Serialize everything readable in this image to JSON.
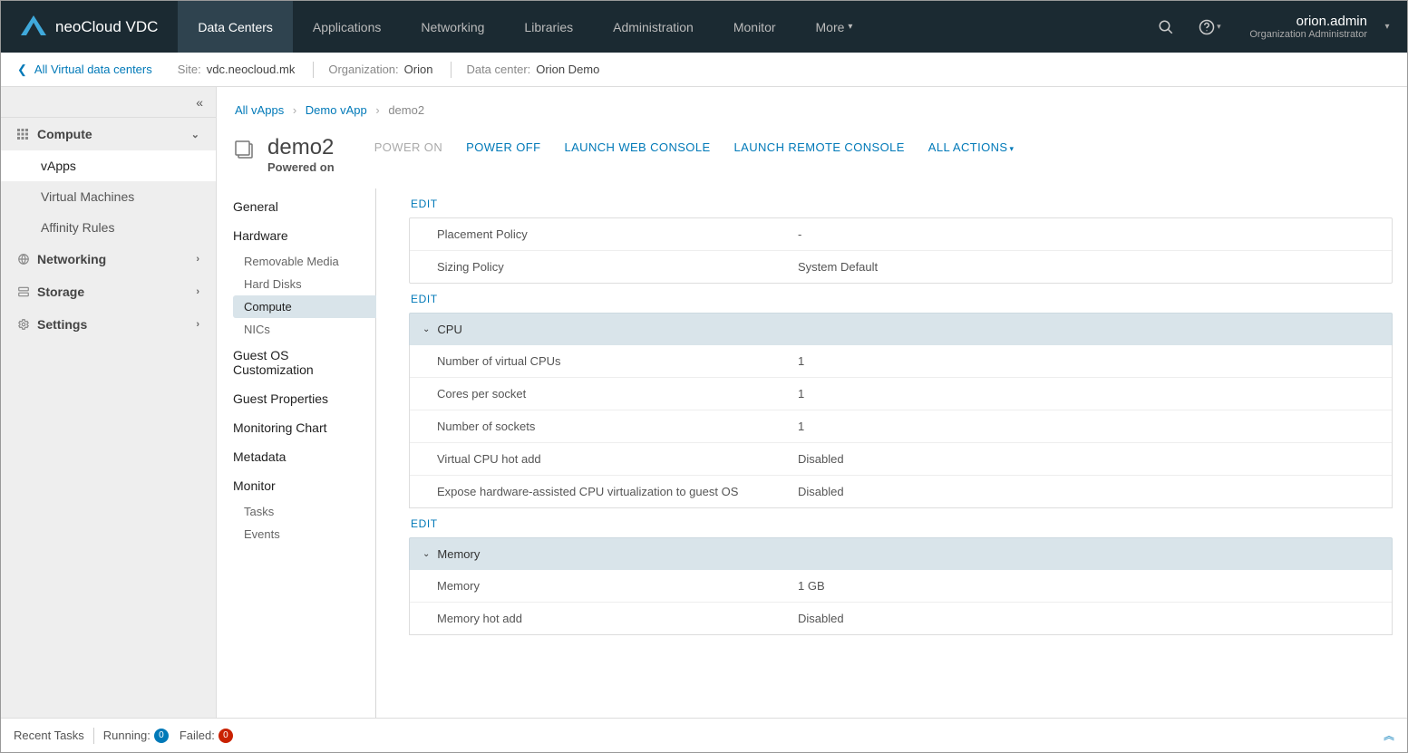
{
  "brand": "neoCloud VDC",
  "nav": {
    "tabs": [
      {
        "label": "Data Centers",
        "active": true
      },
      {
        "label": "Applications"
      },
      {
        "label": "Networking"
      },
      {
        "label": "Libraries"
      },
      {
        "label": "Administration"
      },
      {
        "label": "Monitor"
      },
      {
        "label": "More",
        "dropdown": true
      }
    ]
  },
  "user": {
    "name": "orion.admin",
    "role": "Organization Administrator"
  },
  "context": {
    "back": "All Virtual data centers",
    "site_lbl": "Site:",
    "site": "vdc.neocloud.mk",
    "org_lbl": "Organization:",
    "org": "Orion",
    "dc_lbl": "Data center:",
    "dc": "Orion Demo"
  },
  "sidebar1": {
    "groups": [
      {
        "label": "Compute",
        "icon": "grid",
        "open": true,
        "items": [
          {
            "label": "vApps",
            "active": true
          },
          {
            "label": "Virtual Machines"
          },
          {
            "label": "Affinity Rules"
          }
        ]
      },
      {
        "label": "Networking",
        "icon": "network",
        "open": false
      },
      {
        "label": "Storage",
        "icon": "storage",
        "open": false
      },
      {
        "label": "Settings",
        "icon": "gear",
        "open": false
      }
    ]
  },
  "crumbs": [
    {
      "label": "All vApps",
      "link": true
    },
    {
      "label": "Demo vApp",
      "link": true
    },
    {
      "label": "demo2",
      "link": false
    }
  ],
  "page": {
    "title": "demo2",
    "status": "Powered on",
    "actions": [
      {
        "label": "POWER ON",
        "disabled": true
      },
      {
        "label": "POWER OFF"
      },
      {
        "label": "LAUNCH WEB CONSOLE"
      },
      {
        "label": "LAUNCH REMOTE CONSOLE"
      },
      {
        "label": "ALL ACTIONS",
        "dropdown": true
      }
    ]
  },
  "sidebar2": [
    {
      "label": "General",
      "type": "head"
    },
    {
      "label": "Hardware",
      "type": "head"
    },
    {
      "label": "Removable Media",
      "type": "sub"
    },
    {
      "label": "Hard Disks",
      "type": "sub"
    },
    {
      "label": "Compute",
      "type": "sub",
      "active": true
    },
    {
      "label": "NICs",
      "type": "sub"
    },
    {
      "label": "Guest OS Customization",
      "type": "head"
    },
    {
      "label": "Guest Properties",
      "type": "head"
    },
    {
      "label": "Monitoring Chart",
      "type": "head"
    },
    {
      "label": "Metadata",
      "type": "head"
    },
    {
      "label": "Monitor",
      "type": "head"
    },
    {
      "label": "Tasks",
      "type": "sub"
    },
    {
      "label": "Events",
      "type": "sub"
    }
  ],
  "panel": {
    "edit_label": "EDIT",
    "policy_rows": [
      {
        "k": "Placement Policy",
        "v": "-"
      },
      {
        "k": "Sizing Policy",
        "v": "System Default"
      }
    ],
    "cpu_title": "CPU",
    "cpu_rows": [
      {
        "k": "Number of virtual CPUs",
        "v": "1"
      },
      {
        "k": "Cores per socket",
        "v": "1"
      },
      {
        "k": "Number of sockets",
        "v": "1"
      },
      {
        "k": "Virtual CPU hot add",
        "v": "Disabled"
      },
      {
        "k": "Expose hardware-assisted CPU virtualization to guest OS",
        "v": "Disabled"
      }
    ],
    "mem_title": "Memory",
    "mem_rows": [
      {
        "k": "Memory",
        "v": "1 GB"
      },
      {
        "k": "Memory hot add",
        "v": "Disabled"
      }
    ]
  },
  "footer": {
    "recent": "Recent Tasks",
    "running_lbl": "Running:",
    "running": "0",
    "failed_lbl": "Failed:",
    "failed": "0"
  }
}
